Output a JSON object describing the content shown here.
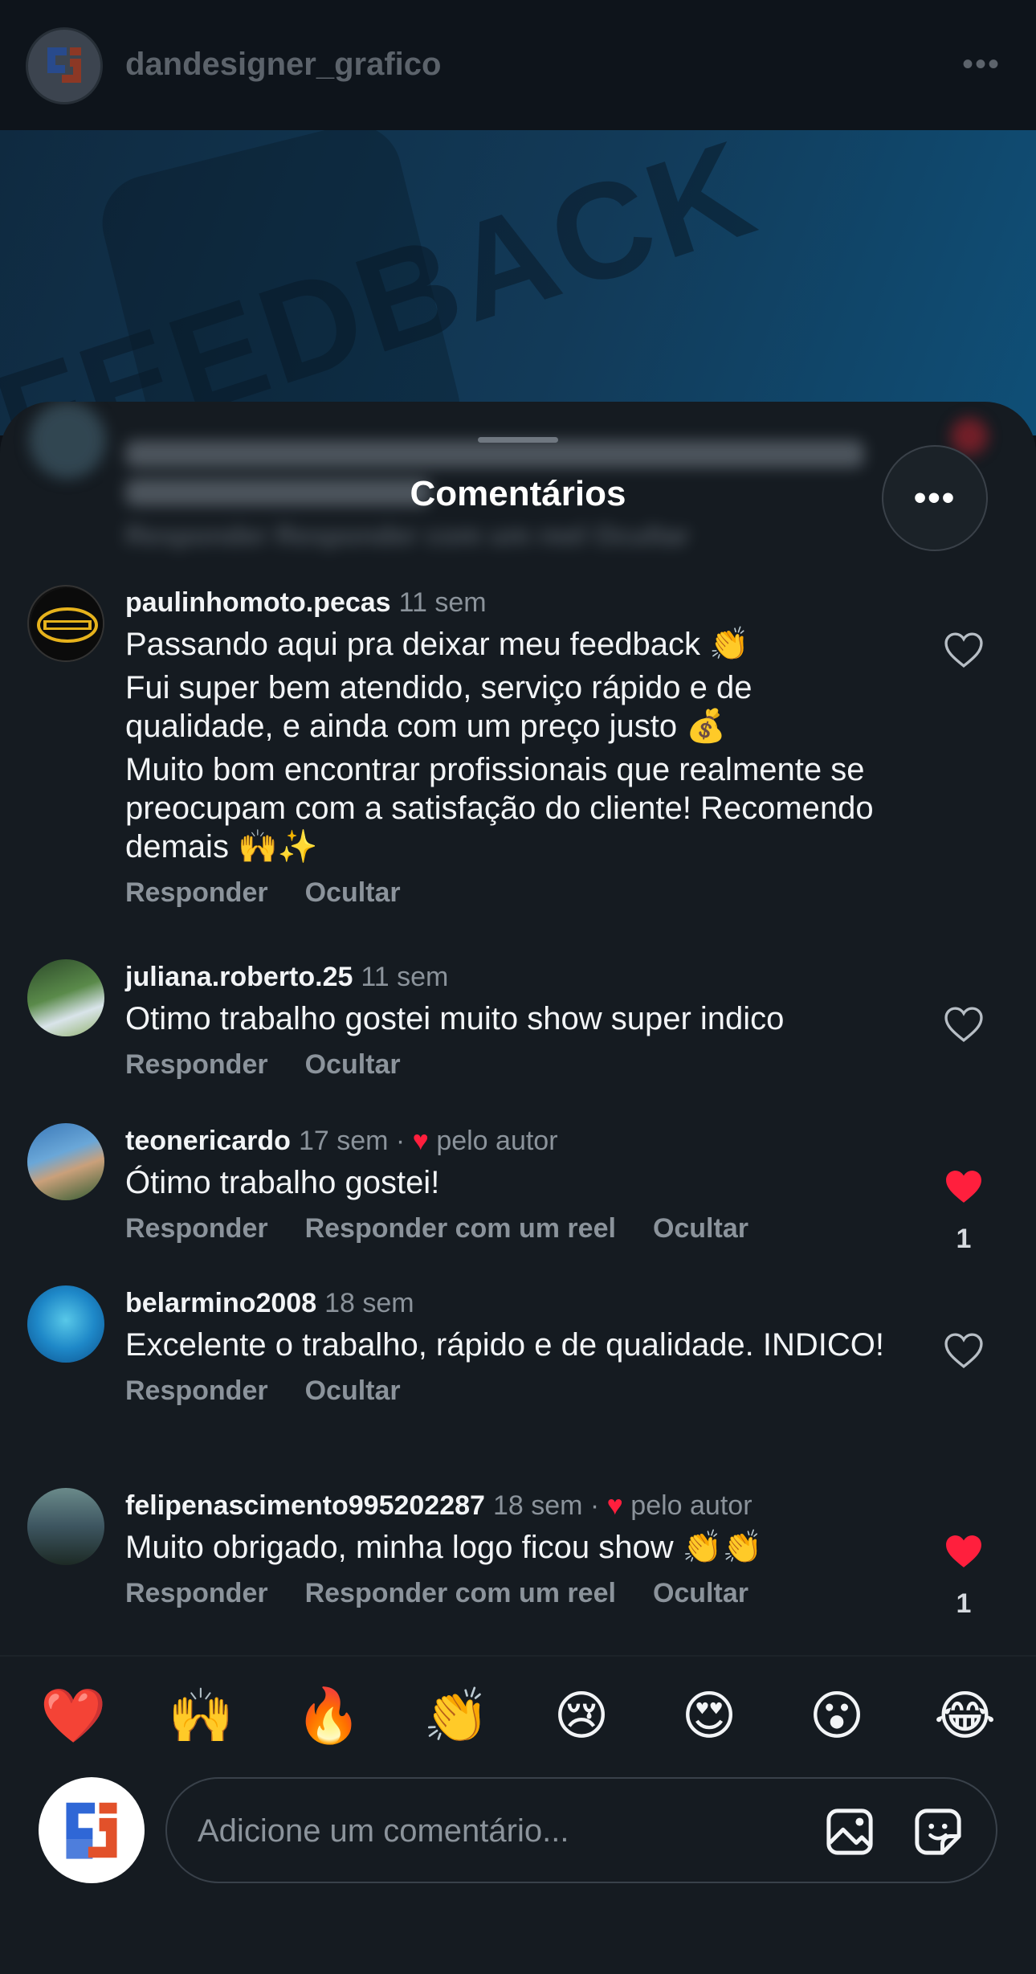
{
  "post": {
    "username": "dandesigner_grafico",
    "more_label": "•••",
    "image_text": "FEEDBACK"
  },
  "sheet": {
    "title": "Comentários",
    "more_label": "•••",
    "blurred_actions": "Responder     Responder com um reel     Ocultar"
  },
  "comments": [
    {
      "user": "paulinhomoto.pecas",
      "time": "11 sem",
      "author_like": "",
      "lines": [
        "Passando aqui pra deixar meu feedback 👏",
        "Fui super bem atendido, serviço rápido e de qualidade, e ainda com um preço justo 💰",
        "Muito bom encontrar profissionais que realmente se preocupam com a satisfação do cliente! Recomendo demais 🙌✨"
      ],
      "actions": [
        "Responder",
        "Ocultar"
      ],
      "liked": false,
      "like_count": ""
    },
    {
      "user": "juliana.roberto.25",
      "time": "11 sem",
      "author_like": "",
      "lines": [
        "Otimo trabalho gostei muito show super indico"
      ],
      "actions": [
        "Responder",
        "Ocultar"
      ],
      "liked": false,
      "like_count": ""
    },
    {
      "user": "teonericardo",
      "time": "17 sem ·",
      "author_like": "pelo autor",
      "lines": [
        "Ótimo trabalho gostei!"
      ],
      "actions": [
        "Responder",
        "Responder com um reel",
        "Ocultar"
      ],
      "liked": true,
      "like_count": "1"
    },
    {
      "user": "belarmino2008",
      "time": "18 sem",
      "author_like": "",
      "lines": [
        "Excelente o trabalho, rápido e de qualidade. INDICO!"
      ],
      "actions": [
        "Responder",
        "Ocultar"
      ],
      "liked": false,
      "like_count": ""
    },
    {
      "user": "felipenascimento995202287",
      "time": "18 sem ·",
      "author_like": "pelo autor",
      "lines": [
        "Muito obrigado, minha logo ficou show 👏👏"
      ],
      "actions": [
        "Responder",
        "Responder com um reel",
        "Ocultar"
      ],
      "liked": true,
      "like_count": "1"
    }
  ],
  "emojis": [
    "❤️",
    "🙌",
    "🔥",
    "👏",
    "😢",
    "😍",
    "😮",
    "😂"
  ],
  "composer": {
    "placeholder": "Adicione um comentário..."
  },
  "colors": {
    "sheet_bg": "#151b21",
    "like_red": "#ff1f3d",
    "muted": "#8b939b"
  }
}
